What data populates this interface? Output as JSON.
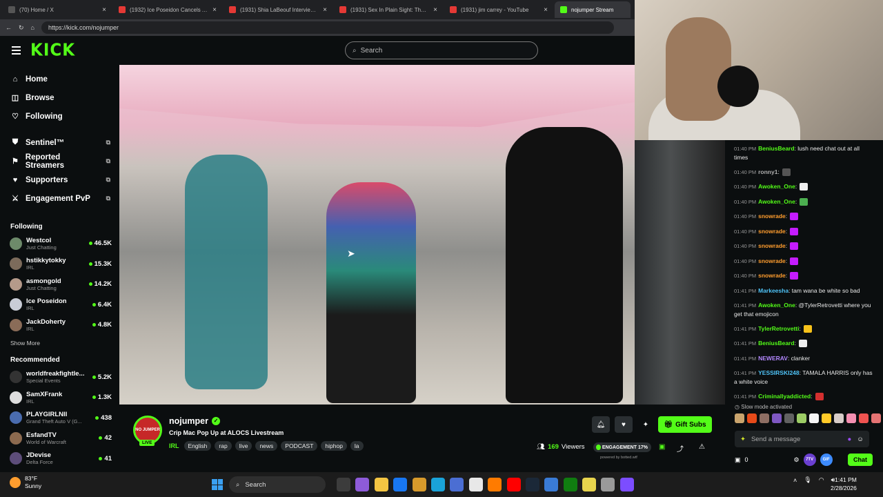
{
  "browser": {
    "tabs": [
      {
        "label": "(70) Home / X",
        "color": "#555555",
        "active": false
      },
      {
        "label": "(1932) Ice Poseidon Cancels Ama...",
        "color": "#e53935",
        "active": false
      },
      {
        "label": "(1931) Shia LaBeouf Interview - Yo",
        "color": "#e53935",
        "active": false
      },
      {
        "label": "(1931) Sex In Plain Sight: The Figu",
        "color": "#e53935",
        "active": false
      },
      {
        "label": "(1931) jim carrey - YouTube",
        "color": "#e53935",
        "active": false
      },
      {
        "label": "nojumper Stream",
        "color": "#53fc18",
        "active": true
      }
    ],
    "url": "https://kick.com/nojumper"
  },
  "header": {
    "logo": "KICK",
    "search_placeholder": "Search"
  },
  "sidebar": {
    "nav": [
      {
        "label": "Home",
        "icon": "home-icon",
        "glyph": "⌂"
      },
      {
        "label": "Browse",
        "icon": "browse-icon",
        "glyph": "◫"
      },
      {
        "label": "Following",
        "icon": "heart-icon",
        "glyph": "♡"
      }
    ],
    "extensions": [
      {
        "label": "Sentinel™",
        "icon": "shield-icon",
        "glyph": "⛊"
      },
      {
        "label": "Reported Streamers",
        "icon": "flag-icon",
        "glyph": "⚑"
      },
      {
        "label": "Supporters",
        "icon": "heart-icon",
        "glyph": "♥"
      },
      {
        "label": "Engagement PvP",
        "icon": "swords-icon",
        "glyph": "⚔"
      }
    ],
    "following_title": "Following",
    "following": [
      {
        "name": "Westcol",
        "category": "Just Chatting",
        "viewers": "46.5K",
        "color": "#6d8a6a"
      },
      {
        "name": "hstikkytokky",
        "category": "IRL",
        "viewers": "15.3K",
        "color": "#7c6b5b"
      },
      {
        "name": "asmongold",
        "category": "Just Chatting",
        "viewers": "14.2K",
        "color": "#b59a8a"
      },
      {
        "name": "Ice Poseidon",
        "category": "IRL",
        "viewers": "6.4K",
        "color": "#c9ccd6"
      },
      {
        "name": "JackDoherty",
        "category": "IRL",
        "viewers": "4.8K",
        "color": "#8a6c58"
      }
    ],
    "show_more": "Show More",
    "recommended_title": "Recommended",
    "recommended": [
      {
        "name": "worldfreakfightle...",
        "category": "Special Events",
        "viewers": "5.2K",
        "color": "#333333"
      },
      {
        "name": "SamXFrank",
        "category": "IRL",
        "viewers": "1.3K",
        "color": "#dddddd"
      },
      {
        "name": "PLAYGIRLNII",
        "category": "Grand Theft Auto V (G...",
        "viewers": "438",
        "color": "#4a6cae"
      },
      {
        "name": "EsfandTV",
        "category": "World of Warcraft",
        "viewers": "42",
        "color": "#8c6a4f"
      },
      {
        "name": "JDevise",
        "category": "Delta Force",
        "viewers": "41",
        "color": "#5d4d7a"
      }
    ]
  },
  "chat": {
    "messages": [
      {
        "time": "01:40 PM",
        "user": "BeniusBeard",
        "color": "#53fc18",
        "text": ": lush need chat out at all times",
        "emote": ""
      },
      {
        "time": "01:40 PM",
        "user": "ronny1",
        "color": "#b0b0b0",
        "text": ":",
        "emote": "#555555"
      },
      {
        "time": "01:40 PM",
        "user": "Awoken_One",
        "color": "#53fc18",
        "text": ":",
        "emote": "#eeeeee"
      },
      {
        "time": "01:40 PM",
        "user": "Awoken_One",
        "color": "#53fc18",
        "text": ":",
        "emote": "#4caf50"
      },
      {
        "time": "01:40 PM",
        "user": "snowrade",
        "color": "#ff9d2e",
        "text": ":",
        "emote": "#c51cff"
      },
      {
        "time": "01:40 PM",
        "user": "snowrade",
        "color": "#ff9d2e",
        "text": ":",
        "emote": "#c51cff"
      },
      {
        "time": "01:40 PM",
        "user": "snowrade",
        "color": "#ff9d2e",
        "text": ":",
        "emote": "#c51cff"
      },
      {
        "time": "01:40 PM",
        "user": "snowrade",
        "color": "#ff9d2e",
        "text": ":",
        "emote": "#c51cff"
      },
      {
        "time": "01:40 PM",
        "user": "snowrade",
        "color": "#ff9d2e",
        "text": ":",
        "emote": "#c51cff"
      },
      {
        "time": "01:41 PM",
        "user": "Markeesha",
        "color": "#4fc3f7",
        "text": ": tam wana be white so bad",
        "emote": ""
      },
      {
        "time": "01:41 PM",
        "user": "Awoken_One",
        "color": "#53fc18",
        "text": ": @TylerRetrovetti where you get that emojicon",
        "emote": ""
      },
      {
        "time": "01:41 PM",
        "user": "TylerRetrovetti",
        "color": "#53fc18",
        "text": ":",
        "emote": "#f7c21a"
      },
      {
        "time": "01:41 PM",
        "user": "BeniusBeard",
        "color": "#53fc18",
        "text": ":",
        "emote": "#eeeeee"
      },
      {
        "time": "01:41 PM",
        "user": "NEWERAV",
        "color": "#b388ff",
        "text": ": clanker",
        "emote": ""
      },
      {
        "time": "01:41 PM",
        "user": "YESSIRSKI248",
        "color": "#4fc3f7",
        "text": ": TAMALA HARRIS only has a white voice",
        "emote": ""
      },
      {
        "time": "01:41 PM",
        "user": "Criminallyaddicted",
        "color": "#53fc18",
        "text": ":",
        "emote": "#d32f2f"
      }
    ],
    "slow_mode": "Slow mode activated",
    "input_placeholder": "Send a message",
    "points": "0",
    "badge_7tv": "7TV",
    "badge_gif": "GIF",
    "chat_button": "Chat",
    "emote_colors": [
      "#c9a46d",
      "#e64a19",
      "#8d6e63",
      "#7e57c2",
      "#616161",
      "#9ccc65",
      "#f5f5f5",
      "#ffca28",
      "#d7ccc8",
      "#f48fb1",
      "#ef5350",
      "#e57373"
    ]
  },
  "stream": {
    "avatar_text": "NO JUMPER",
    "live_label": "LIVE",
    "streamer": "nojumper",
    "title": "Crip Mac Pop Up at ALOCS Livestream",
    "category": "IRL",
    "tags": [
      "English",
      "rap",
      "live",
      "news",
      "PODCAST",
      "hiphop",
      "la"
    ],
    "viewers": "169",
    "viewers_label": "Viewers",
    "engagement_label": "ENGAGEMENT",
    "engagement_pct": "17%",
    "powered_by": "powered by botted.wtf",
    "gift_label": "Gift Subs"
  },
  "taskbar": {
    "temp": "83°F",
    "weather": "Sunny",
    "search": "Search",
    "time": "1:41 PM",
    "date": "2/28/2026",
    "app_colors": [
      "#3c3c3c",
      "#8e5bd9",
      "#f4c542",
      "#1877f2",
      "#d89a2b",
      "#1aa3d9",
      "#4b6ed3",
      "#e8e8e8",
      "#ff7b00",
      "#ff0000",
      "#1b2838",
      "#3a7bd5",
      "#107c10",
      "#e8d44d",
      "#9a9a9a",
      "#7c4dff"
    ]
  }
}
